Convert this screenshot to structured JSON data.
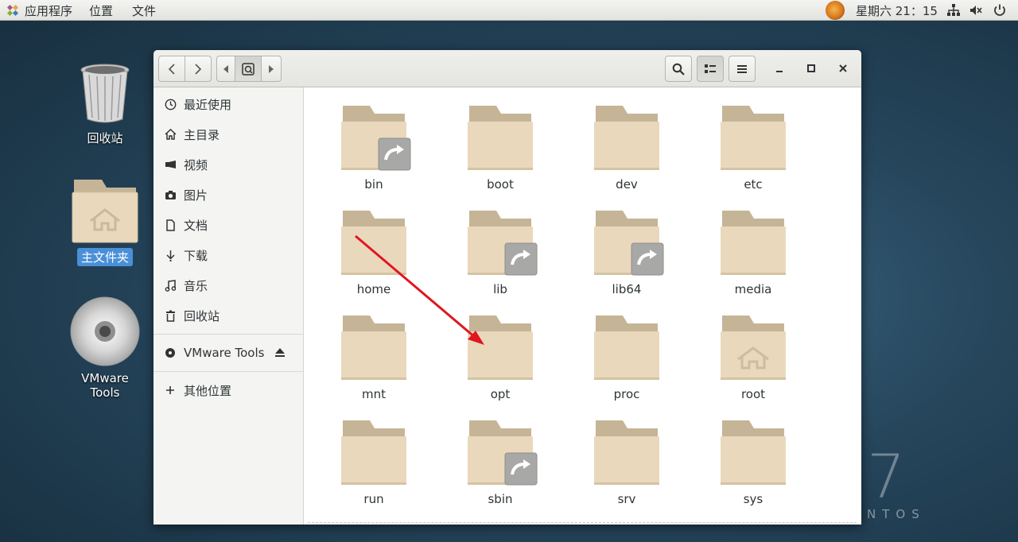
{
  "topbar": {
    "menus": [
      "应用程序",
      "位置",
      "文件"
    ],
    "clock": "星期六  21：15"
  },
  "desktop": {
    "icons": [
      {
        "label": "回收站"
      },
      {
        "label": "主文件夹"
      },
      {
        "label": "VMware Tools"
      }
    ],
    "watermark": "NTOS",
    "big_number": "7"
  },
  "sidebar": {
    "items": [
      {
        "label": "最近使用",
        "icon": "clock-icon"
      },
      {
        "label": "主目录",
        "icon": "home-icon"
      },
      {
        "label": "视频",
        "icon": "video-icon"
      },
      {
        "label": "图片",
        "icon": "camera-icon"
      },
      {
        "label": "文档",
        "icon": "document-icon"
      },
      {
        "label": "下载",
        "icon": "download-icon"
      },
      {
        "label": "音乐",
        "icon": "music-icon"
      },
      {
        "label": "回收站",
        "icon": "trash-icon"
      }
    ],
    "device": {
      "label": "VMware Tools",
      "icon": "disc-icon"
    },
    "other": {
      "label": "其他位置",
      "icon": "plus-icon"
    }
  },
  "files": [
    {
      "name": "bin",
      "link": true
    },
    {
      "name": "boot",
      "link": false
    },
    {
      "name": "dev",
      "link": false
    },
    {
      "name": "etc",
      "link": false
    },
    {
      "name": "home",
      "link": false
    },
    {
      "name": "lib",
      "link": true
    },
    {
      "name": "lib64",
      "link": true
    },
    {
      "name": "media",
      "link": false
    },
    {
      "name": "mnt",
      "link": false
    },
    {
      "name": "opt",
      "link": false
    },
    {
      "name": "proc",
      "link": false
    },
    {
      "name": "root",
      "link": false,
      "home_emblem": true
    },
    {
      "name": "run",
      "link": false
    },
    {
      "name": "sbin",
      "link": true
    },
    {
      "name": "srv",
      "link": false
    },
    {
      "name": "sys",
      "link": false
    }
  ],
  "colors": {
    "folder_back": "#c5b596",
    "folder_front": "#ead8bd",
    "accent": "#4a90d9",
    "arrow": "#e0161f"
  }
}
